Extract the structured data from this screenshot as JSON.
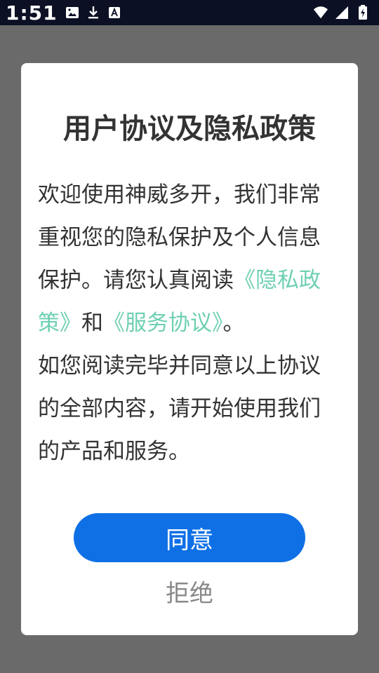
{
  "status_bar": {
    "time": "1:51",
    "left_icons": [
      "image-icon",
      "download-icon",
      "a-icon"
    ],
    "right_icons": [
      "wifi-icon",
      "signal-icon",
      "battery-icon"
    ]
  },
  "dialog": {
    "title": "用户协议及隐私政策",
    "body": {
      "p1_text_1": "欢迎使用神威多开，我们非常重视您的隐私保护及个人信息保护。请您认真阅读",
      "privacy_link": "《隐私政策》",
      "p1_text_2": "和",
      "service_link": "《服务协议》",
      "p1_text_3": "。",
      "p2_text": "如您阅读完毕并同意以上协议的全部内容，请开始使用我们的产品和服务。"
    },
    "agree_label": "同意",
    "reject_label": "拒绝"
  },
  "colors": {
    "overlay": "#6a6a6a",
    "status_bar": "#0b1024",
    "link": "#6fd0b3",
    "primary_button": "#0f70e6",
    "reject_text": "#888888"
  }
}
